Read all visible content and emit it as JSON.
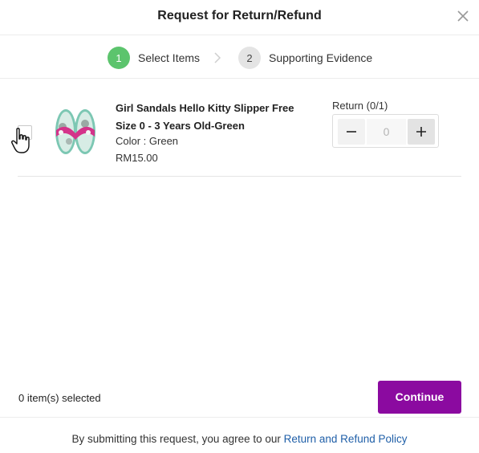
{
  "header": {
    "title": "Request for Return/Refund",
    "close_icon": "close-icon"
  },
  "steps": [
    {
      "number": "1",
      "label": "Select Items",
      "state": "active"
    },
    {
      "number": "2",
      "label": "Supporting Evidence",
      "state": "inactive"
    }
  ],
  "colors": {
    "active_step": "#5cc46d",
    "continue_button": "#8b0aa0",
    "policy_link": "#1f5fa8"
  },
  "item": {
    "name": "Girl Sandals Hello Kitty Slipper Free Size 0 - 3 Years Old-Green",
    "variation": "Color : Green",
    "price": "RM15.00",
    "return_label": "Return (0/1)",
    "quantity": "0",
    "checked": false
  },
  "footer": {
    "selected_text": "0 item(s) selected",
    "continue_label": "Continue"
  },
  "agreement": {
    "prefix": "By submitting this request, you agree to our ",
    "link": "Return and Refund Policy"
  }
}
